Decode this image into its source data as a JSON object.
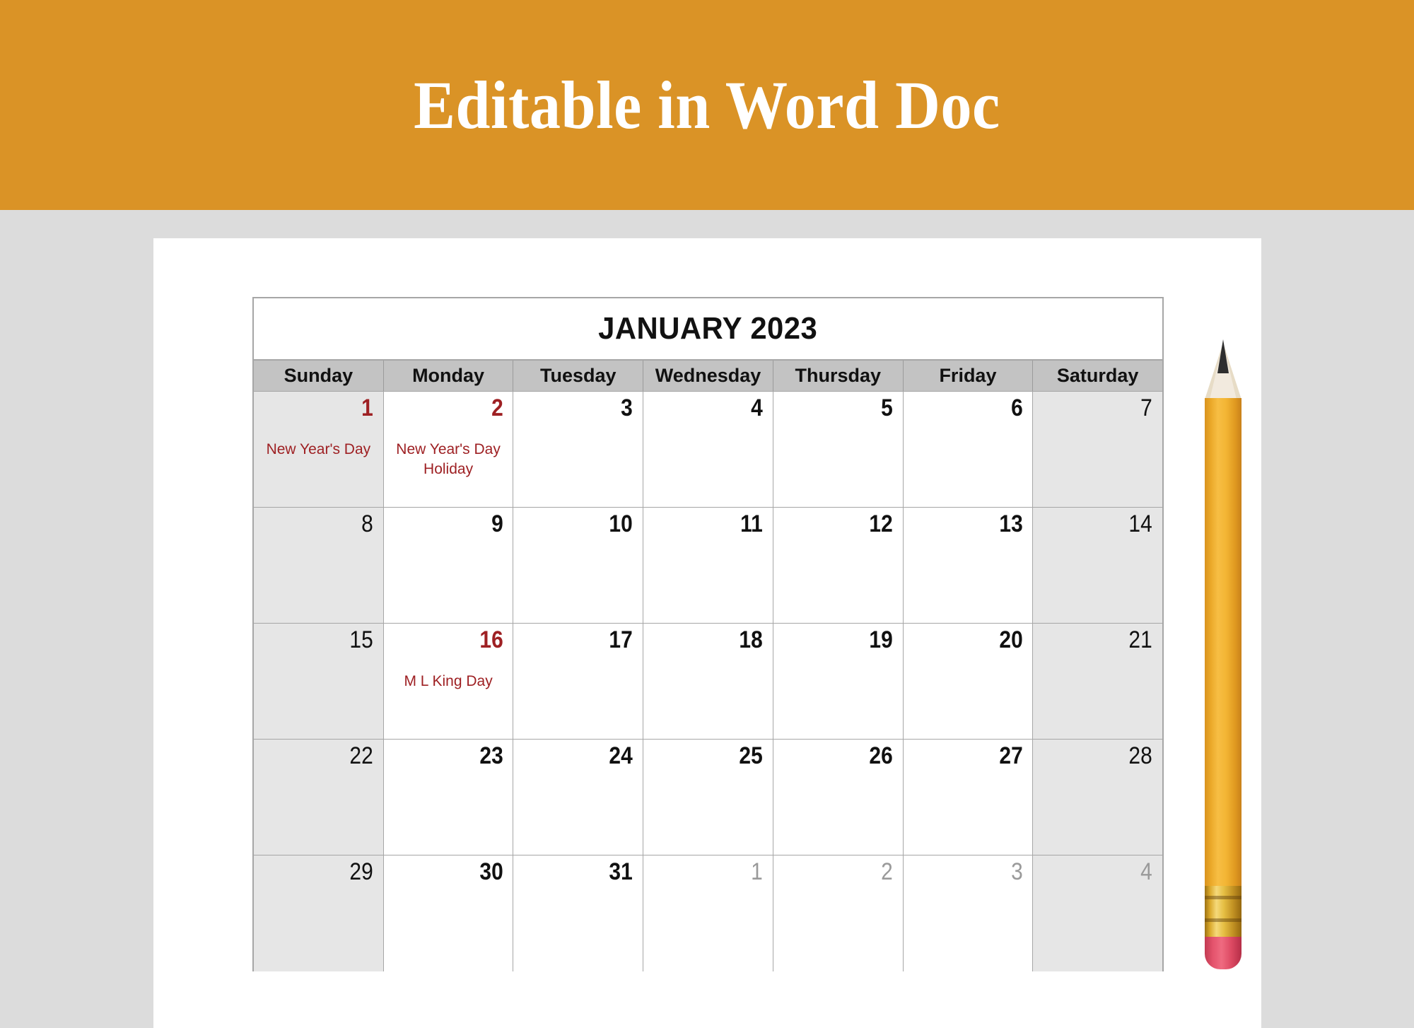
{
  "banner": {
    "title": "Editable in Word Doc",
    "background_color": "#da9326",
    "text_color": "#ffffff"
  },
  "page": {
    "background_color": "#dcdcdc",
    "sheet_color": "#ffffff"
  },
  "calendar": {
    "title": "JANUARY 2023",
    "month": "JANUARY",
    "year": "2023",
    "header_background": "#c3c3c3",
    "weekend_background": "#e6e6e6",
    "holiday_color": "#9e2023",
    "other_month_color": "#9a9a9a",
    "day_headers": [
      "Sunday",
      "Monday",
      "Tuesday",
      "Wednesday",
      "Thursday",
      "Friday",
      "Saturday"
    ],
    "weeks": [
      [
        {
          "num": "1",
          "style": "holiday",
          "event": "New Year's Day"
        },
        {
          "num": "2",
          "style": "holiday",
          "event": "New Year's Day\nHoliday"
        },
        {
          "num": "3",
          "style": "bold",
          "event": ""
        },
        {
          "num": "4",
          "style": "bold",
          "event": ""
        },
        {
          "num": "5",
          "style": "bold",
          "event": ""
        },
        {
          "num": "6",
          "style": "bold",
          "event": ""
        },
        {
          "num": "7",
          "style": "light",
          "event": ""
        }
      ],
      [
        {
          "num": "8",
          "style": "light",
          "event": ""
        },
        {
          "num": "9",
          "style": "bold",
          "event": ""
        },
        {
          "num": "10",
          "style": "bold",
          "event": ""
        },
        {
          "num": "11",
          "style": "bold",
          "event": ""
        },
        {
          "num": "12",
          "style": "bold",
          "event": ""
        },
        {
          "num": "13",
          "style": "bold",
          "event": ""
        },
        {
          "num": "14",
          "style": "light",
          "event": ""
        }
      ],
      [
        {
          "num": "15",
          "style": "light",
          "event": ""
        },
        {
          "num": "16",
          "style": "holiday",
          "event": "M L King Day"
        },
        {
          "num": "17",
          "style": "bold",
          "event": ""
        },
        {
          "num": "18",
          "style": "bold",
          "event": ""
        },
        {
          "num": "19",
          "style": "bold",
          "event": ""
        },
        {
          "num": "20",
          "style": "bold",
          "event": ""
        },
        {
          "num": "21",
          "style": "light",
          "event": ""
        }
      ],
      [
        {
          "num": "22",
          "style": "light",
          "event": ""
        },
        {
          "num": "23",
          "style": "bold",
          "event": ""
        },
        {
          "num": "24",
          "style": "bold",
          "event": ""
        },
        {
          "num": "25",
          "style": "bold",
          "event": ""
        },
        {
          "num": "26",
          "style": "bold",
          "event": ""
        },
        {
          "num": "27",
          "style": "bold",
          "event": ""
        },
        {
          "num": "28",
          "style": "light",
          "event": ""
        }
      ],
      [
        {
          "num": "29",
          "style": "light",
          "event": ""
        },
        {
          "num": "30",
          "style": "bold",
          "event": ""
        },
        {
          "num": "31",
          "style": "bold",
          "event": ""
        },
        {
          "num": "1",
          "style": "other-month",
          "event": ""
        },
        {
          "num": "2",
          "style": "other-month",
          "event": ""
        },
        {
          "num": "3",
          "style": "other-month",
          "event": ""
        },
        {
          "num": "4",
          "style": "other-month",
          "event": ""
        }
      ]
    ]
  },
  "decor": {
    "pencil": {
      "body_color": "#f0ae2f",
      "ferrule_color": "#ddb13a",
      "eraser_color": "#e0536a",
      "lead_color": "#2e2e2e",
      "wood_color": "#f2eade"
    }
  }
}
